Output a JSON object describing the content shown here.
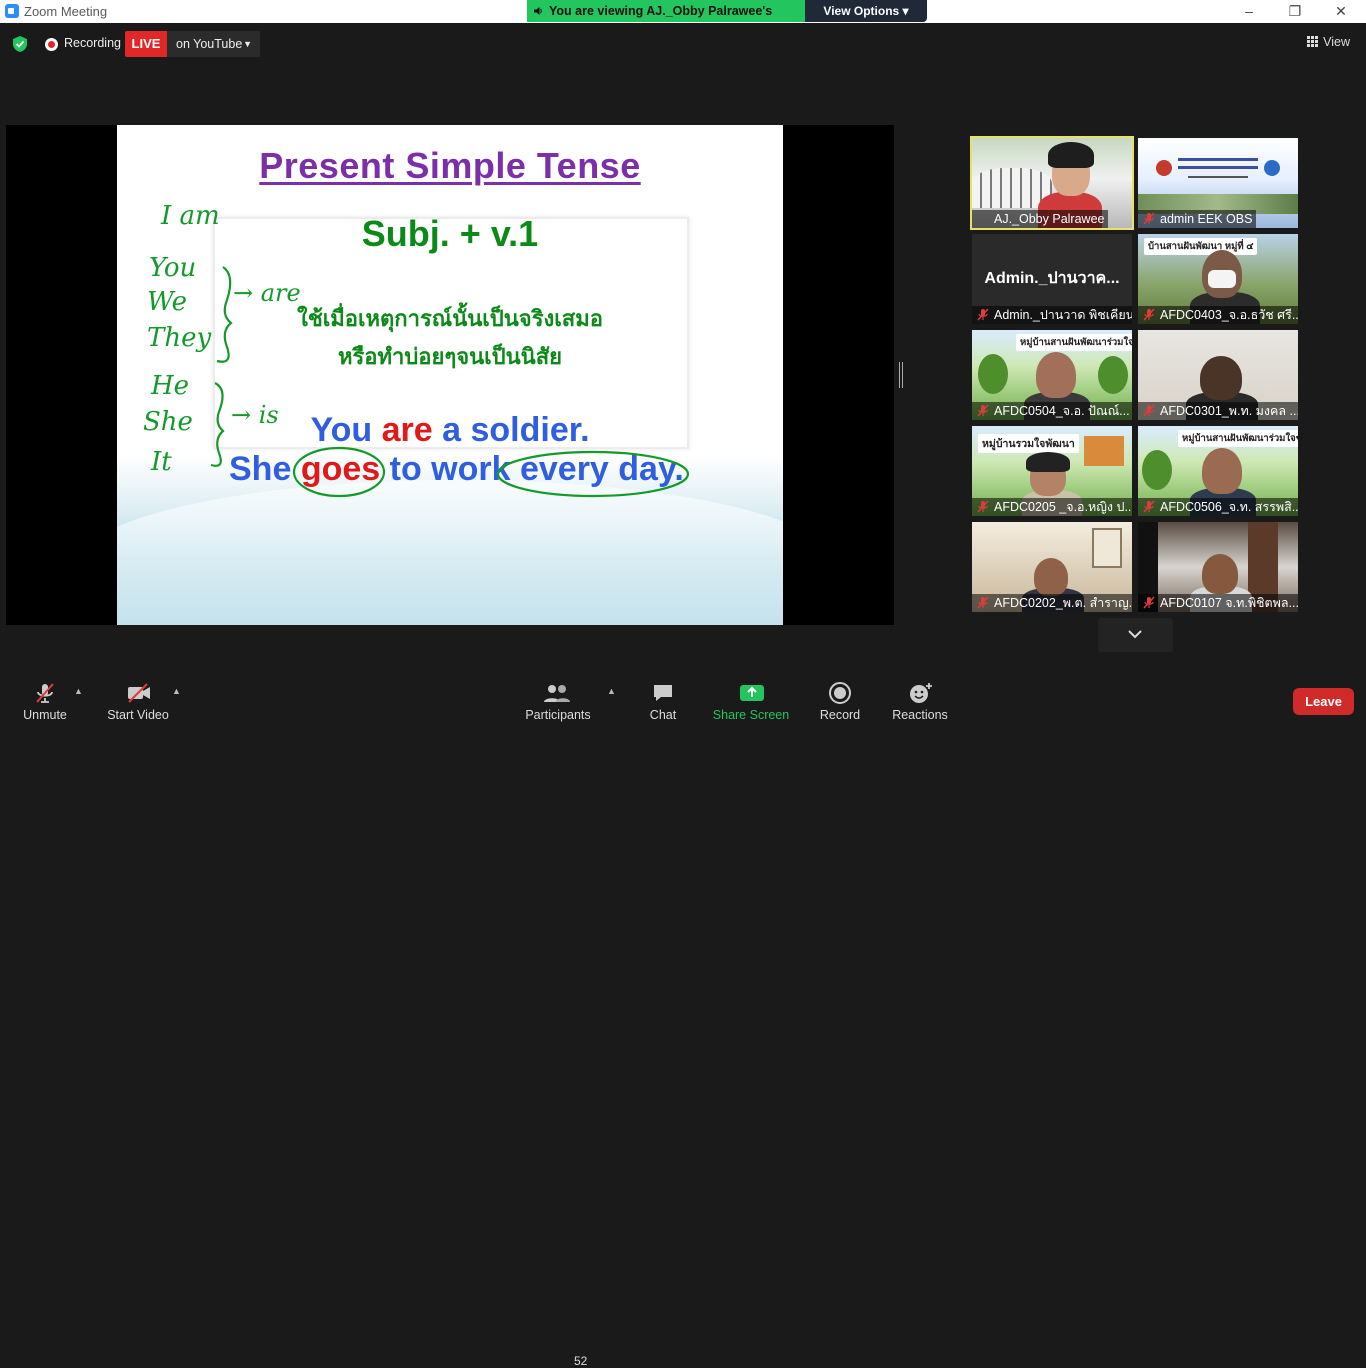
{
  "window": {
    "title": "Zoom Meeting",
    "minimize": "–",
    "restore": "❐",
    "close": "✕"
  },
  "share_banner": {
    "viewing_text": "You are viewing AJ._Obby Palrawee's screen",
    "view_options": "View Options ▾"
  },
  "topbar": {
    "recording_label": "Recording",
    "live_label": "LIVE",
    "live_platform": "on YouTube",
    "view_label": "View"
  },
  "slide": {
    "title": "Present Simple Tense",
    "formula": "Subj. + v.1",
    "thai_line1": "ใช้เมื่อเหตุการณ์นั้นเป็นจริงเสมอ",
    "thai_line2": "หรือทำบ่อยๆจนเป็นนิสัย",
    "example1": {
      "part1": "You ",
      "verb": "are",
      "part2": " a soldier."
    },
    "example2": {
      "subject": "She ",
      "verb": "goes",
      "part2": " to work ",
      "part3": "every day."
    },
    "handwriting": {
      "i_am": "I am",
      "you": "You",
      "we": "We",
      "they": "They",
      "are": "→ are",
      "he": "He",
      "she": "She",
      "it": "It",
      "is": "→ is"
    }
  },
  "gallery": [
    {
      "name": "AJ._Obby Palrawee",
      "active": true
    },
    {
      "name": "admin EEK OBS"
    },
    {
      "name": "Admin._ปานวาด พิชเคียน",
      "big_name": "Admin._ปานวาค..."
    },
    {
      "name": "AFDC0403_จ.อ.ธวัช ศรี...",
      "banner": "บ้านสานฝันพัฒนา หมู่ที่ ๔"
    },
    {
      "name": "AFDC0504_จ.อ. ปัณณ์...",
      "banner": "หมู่บ้านสานฝันพัฒนาร่วมใจ♥"
    },
    {
      "name": "AFDC0301_พ.ท. มงคล ..."
    },
    {
      "name": "AFDC0205 _จ.อ.หญิง ป...",
      "banner": "หมู่บ้านรวมใจพัฒนา"
    },
    {
      "name": "AFDC0506_จ.ท. สรรพสิ...",
      "banner": "หมู่บ้านสานฝันพัฒนาร่วมใจ♥"
    },
    {
      "name": "AFDC0202_พ.ต. สำราญ..."
    },
    {
      "name": "AFDC0107 จ.ท.พิชิตพล..."
    }
  ],
  "toolbar": {
    "unmute": "Unmute",
    "start_video": "Start Video",
    "participants": "Participants",
    "participants_count": "52",
    "chat": "Chat",
    "share_screen": "Share Screen",
    "record": "Record",
    "reactions": "Reactions",
    "leave": "Leave"
  },
  "colors": {
    "accent_green": "#22c55e",
    "live_red": "#e02828",
    "active_speaker": "#e8e06a",
    "leave_red": "#d02a2a"
  },
  "icons": [
    "shield-icon",
    "record-dot-icon",
    "grid-view-icon",
    "speaker-icon",
    "mic-muted-icon",
    "video-off-icon",
    "participants-icon",
    "chat-icon",
    "share-screen-icon",
    "record-icon",
    "reactions-icon",
    "chevron-down-icon"
  ]
}
